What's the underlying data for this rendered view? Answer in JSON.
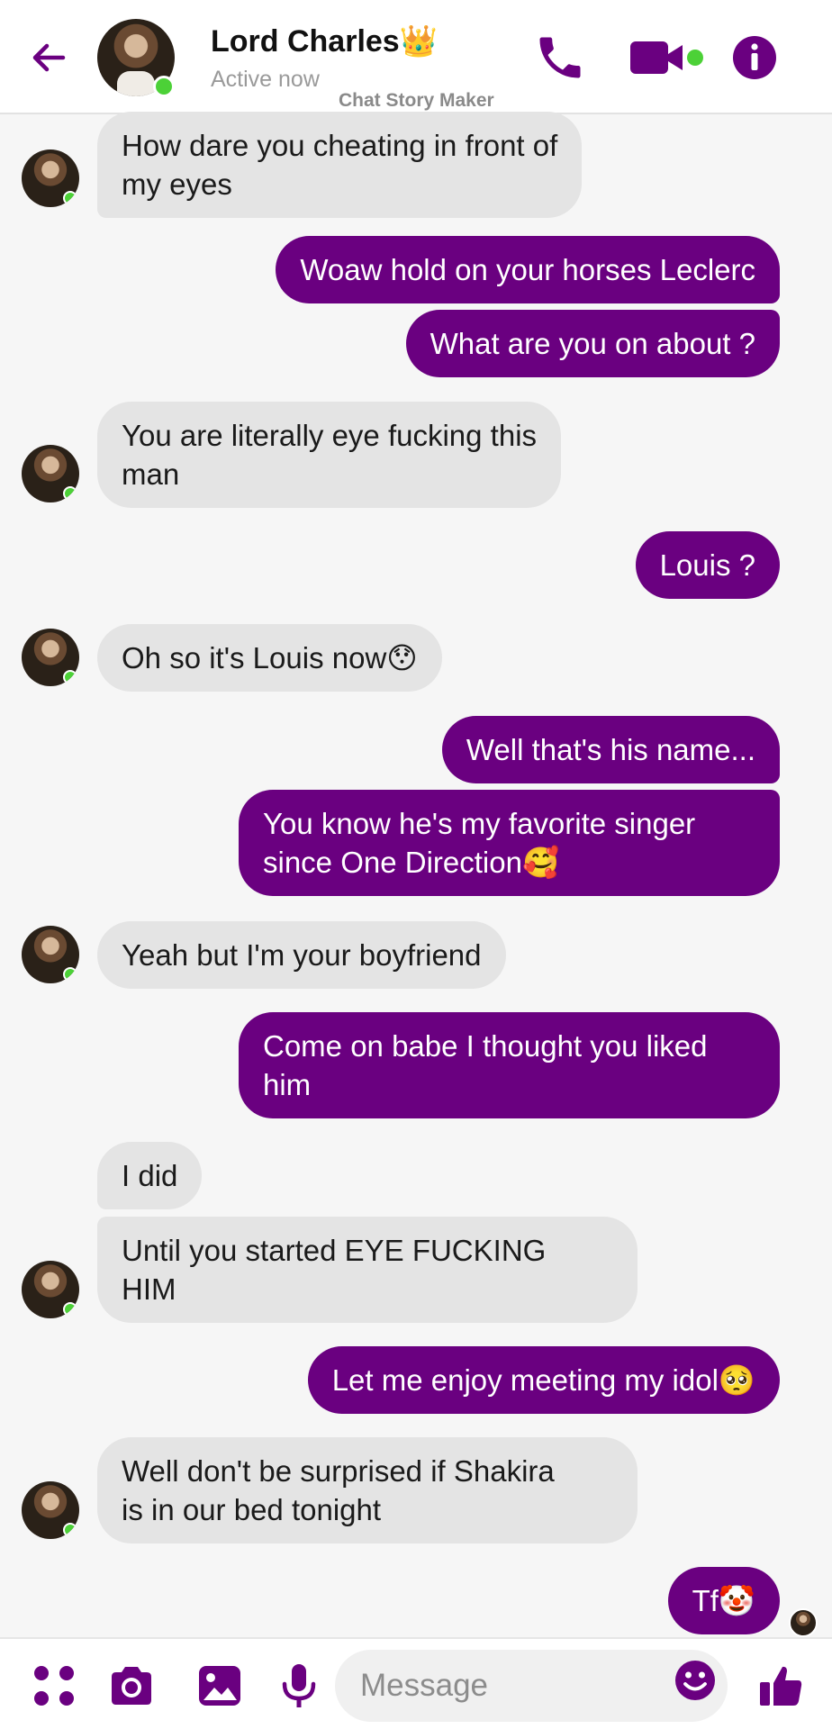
{
  "header": {
    "contact_name": "Lord Charles👑",
    "status": "Active now",
    "watermark": "Chat Story Maker",
    "icons": [
      "back-arrow-icon",
      "phone-icon",
      "video-camera-icon",
      "info-icon"
    ],
    "online_indicator_color": "#4cd137"
  },
  "colors": {
    "accent": "#6a0080",
    "outgoing_bubble": "#6a0080",
    "incoming_bubble": "#e4e4e4",
    "background": "#f6f6f6"
  },
  "messages": [
    {
      "dir": "in",
      "text": "How dare you cheating in front of\nmy eyes"
    },
    {
      "dir": "out",
      "text": "Woaw hold on your horses Leclerc"
    },
    {
      "dir": "out",
      "text": "What are you on about ?"
    },
    {
      "dir": "in",
      "text": "You are literally eye fucking this\nman"
    },
    {
      "dir": "out",
      "text": "Louis ?"
    },
    {
      "dir": "in",
      "text": "Oh so it's Louis now😯"
    },
    {
      "dir": "out",
      "text": "Well that's his name..."
    },
    {
      "dir": "out",
      "text": "You know he's my favorite singer\nsince One Direction🥰"
    },
    {
      "dir": "in",
      "text": "Yeah but I'm your boyfriend"
    },
    {
      "dir": "out",
      "text": "Come on babe I thought you liked\nhim"
    },
    {
      "dir": "in",
      "text": "I did"
    },
    {
      "dir": "in",
      "text": "Until you started EYE FUCKING\nHIM"
    },
    {
      "dir": "out",
      "text": "Let me enjoy meeting my idol🥺"
    },
    {
      "dir": "in",
      "text": "Well don't be surprised if Shakira\nis in our bed tonight"
    },
    {
      "dir": "out",
      "text": "Tf🤡"
    }
  ],
  "composer": {
    "placeholder": "Message",
    "icons": [
      "apps-grid-icon",
      "camera-icon",
      "image-icon",
      "microphone-icon",
      "emoji-icon",
      "thumbs-up-icon"
    ]
  }
}
